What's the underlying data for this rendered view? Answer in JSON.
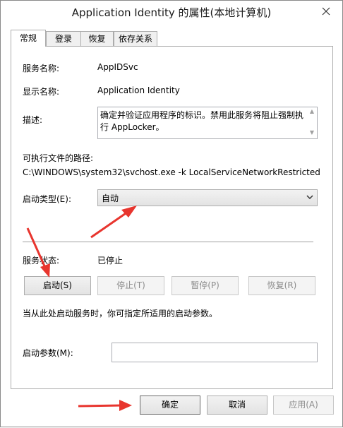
{
  "window": {
    "title": "Application Identity 的属性(本地计算机)"
  },
  "tabs": [
    {
      "label": "常规"
    },
    {
      "label": "登录"
    },
    {
      "label": "恢复"
    },
    {
      "label": "依存关系"
    }
  ],
  "general": {
    "service_name_label": "服务名称:",
    "service_name_value": "AppIDSvc",
    "display_name_label": "显示名称:",
    "display_name_value": "Application Identity",
    "description_label": "描述:",
    "description_value": "确定并验证应用程序的标识。禁用此服务将阻止强制执行 AppLocker。",
    "path_label": "可执行文件的路径:",
    "path_value": "C:\\WINDOWS\\system32\\svchost.exe -k LocalServiceNetworkRestricted",
    "startup_type_label": "启动类型(E):",
    "startup_type_value": "自动",
    "status_label": "服务状态:",
    "status_value": "已停止",
    "start_button": "启动(S)",
    "stop_button": "停止(T)",
    "pause_button": "暂停(P)",
    "resume_button": "恢复(R)",
    "hint": "当从此处启动服务时，你可指定所适用的启动参数。",
    "params_label": "启动参数(M):",
    "params_value": ""
  },
  "footer": {
    "ok_button": "确定",
    "cancel_button": "取消",
    "apply_button": "应用(A)"
  },
  "colors": {
    "annotation_arrow": "#e8352e"
  },
  "icons": [
    "close-icon",
    "dropdown-arrow-icon",
    "scroll-up-icon",
    "scroll-down-icon",
    "annotation-arrow-icon"
  ]
}
